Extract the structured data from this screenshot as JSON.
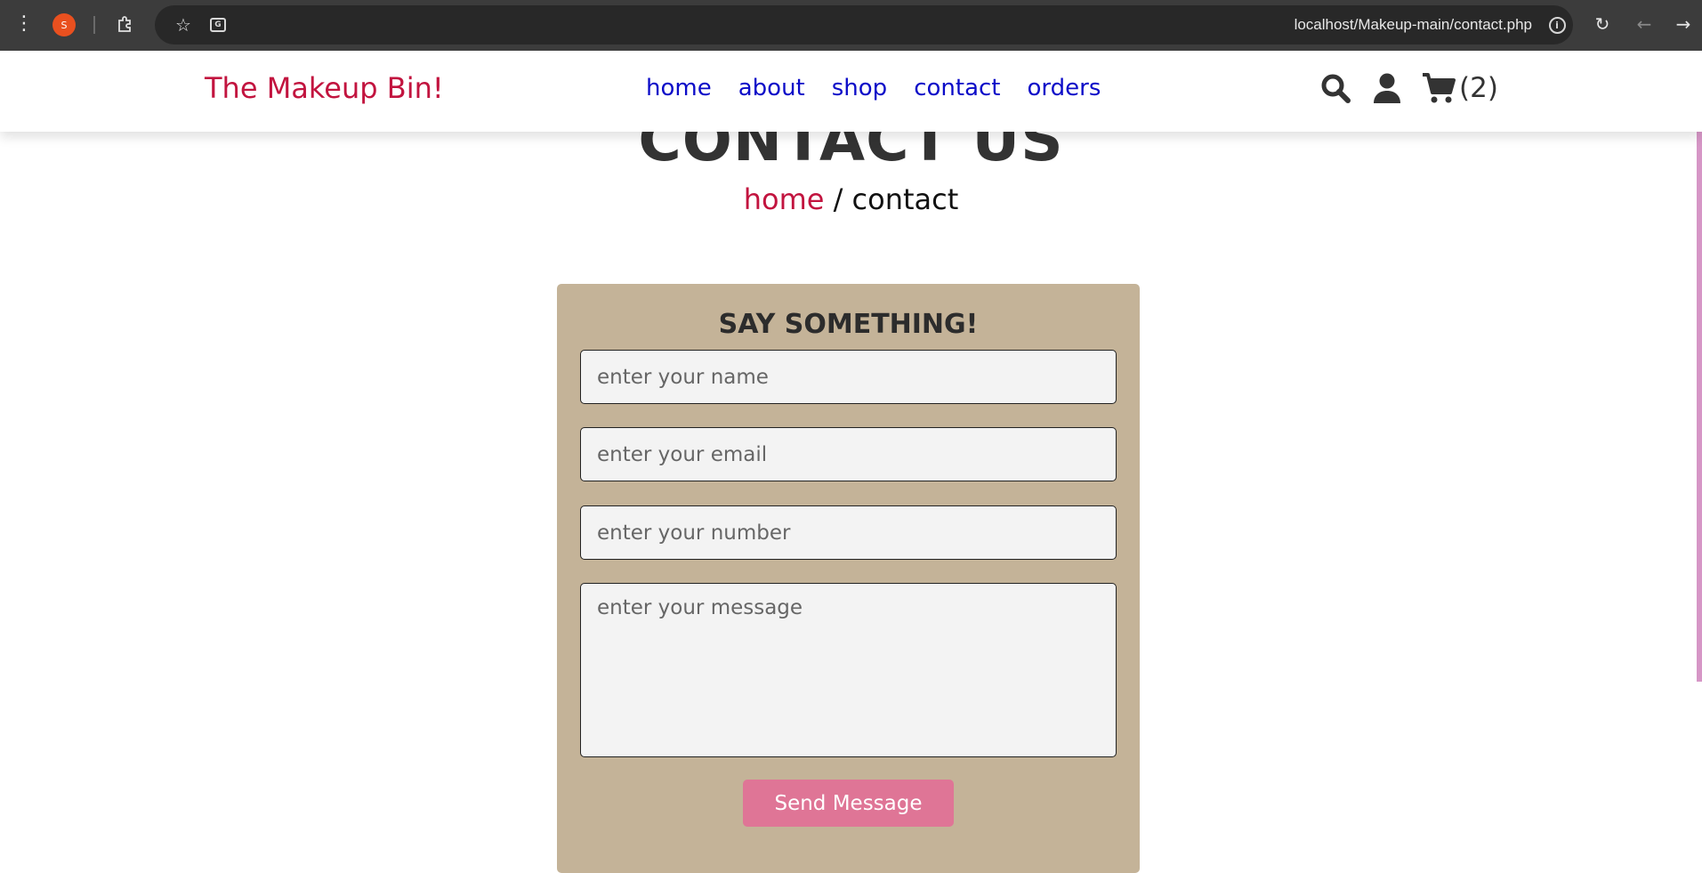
{
  "browser": {
    "url": "localhost/Makeup-main/contact.php",
    "profile_initial": "S",
    "menu_icon": "kebab-menu-icon",
    "extensions_icon": "puzzle-icon",
    "bookmark_icon": "star-icon",
    "translate_icon": "translate-icon",
    "site_info_icon": "info-icon",
    "reload_icon": "reload-icon",
    "back_icon": "back-arrow-icon",
    "forward_icon": "forward-arrow-icon"
  },
  "header": {
    "logo": "The Makeup Bin!",
    "nav": [
      {
        "label": "home"
      },
      {
        "label": "about"
      },
      {
        "label": "shop"
      },
      {
        "label": "contact"
      },
      {
        "label": "orders"
      }
    ],
    "icons": [
      "search-icon",
      "user-icon",
      "cart-icon"
    ],
    "cart_count": "(2)"
  },
  "main": {
    "heading": "CONTACT US",
    "breadcrumb": {
      "home": "home",
      "separator": "/",
      "current": "contact"
    }
  },
  "form": {
    "title": "SAY SOMETHING!",
    "name_placeholder": "enter your name",
    "email_placeholder": "enter your email",
    "number_placeholder": "enter your number",
    "message_placeholder": "enter your message",
    "submit_label": "Send Message"
  },
  "colors": {
    "brand": "#c2143f",
    "nav_link": "#0b0bc8",
    "form_bg": "#c4b398",
    "button": "#df7596"
  }
}
